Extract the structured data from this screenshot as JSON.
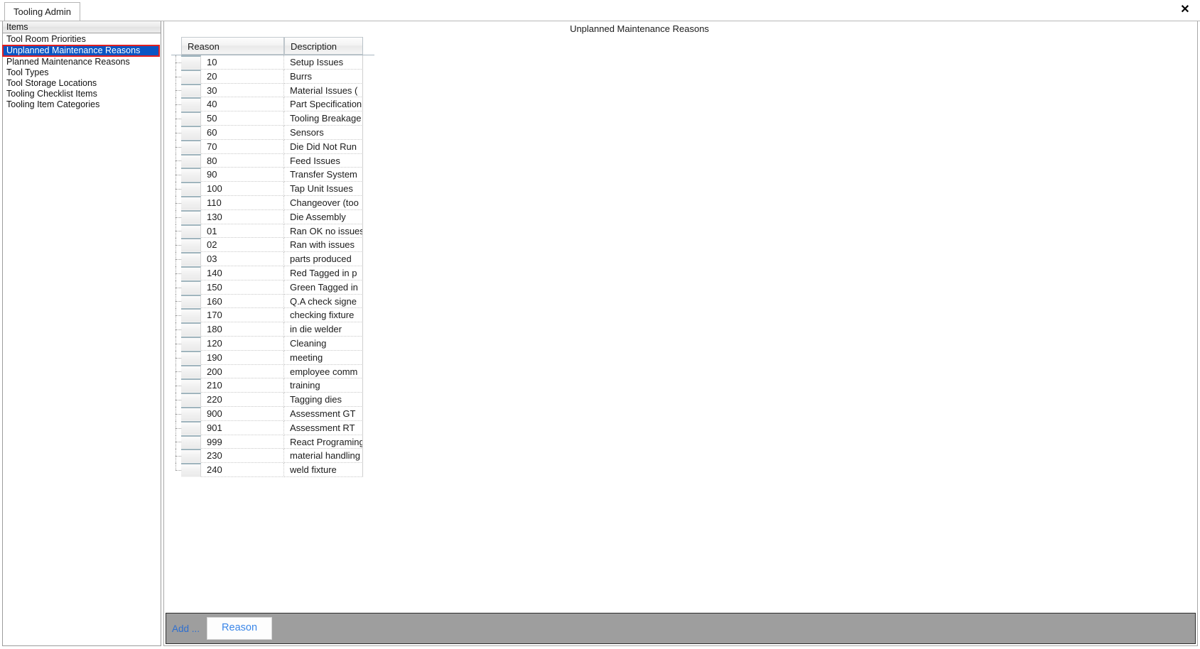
{
  "window": {
    "tab_label": "Tooling Admin",
    "close_icon": "close-icon",
    "close_glyph": "✕"
  },
  "sidebar": {
    "header": "Items",
    "selected_index": 1,
    "selection_colors": {
      "background": "#0a55c4",
      "text": "#ffffff",
      "outline": "#e02020"
    },
    "items": [
      {
        "label": "Tool Room Priorities"
      },
      {
        "label": "Unplanned Maintenance Reasons"
      },
      {
        "label": "Planned Maintenance Reasons"
      },
      {
        "label": "Tool Types"
      },
      {
        "label": "Tool Storage Locations"
      },
      {
        "label": "Tooling Checklist Items"
      },
      {
        "label": "Tooling Item Categories"
      }
    ]
  },
  "content": {
    "title": "Unplanned Maintenance Reasons",
    "grid": {
      "columns": [
        {
          "key": "reason",
          "label": "Reason"
        },
        {
          "key": "description",
          "label": "Description"
        }
      ],
      "rows": [
        {
          "reason": "10",
          "description": "Setup Issues"
        },
        {
          "reason": "20",
          "description": "Burrs"
        },
        {
          "reason": "30",
          "description": "Material Issues ("
        },
        {
          "reason": "40",
          "description": "Part Specification"
        },
        {
          "reason": "50",
          "description": "Tooling Breakage"
        },
        {
          "reason": "60",
          "description": "Sensors"
        },
        {
          "reason": "70",
          "description": "Die Did Not Run"
        },
        {
          "reason": "80",
          "description": "Feed Issues"
        },
        {
          "reason": "90",
          "description": "Transfer System"
        },
        {
          "reason": "100",
          "description": "Tap Unit Issues"
        },
        {
          "reason": "110",
          "description": "Changeover  (too"
        },
        {
          "reason": "130",
          "description": "Die Assembly"
        },
        {
          "reason": "01",
          "description": "Ran OK no issues"
        },
        {
          "reason": "02",
          "description": "Ran with issues"
        },
        {
          "reason": "03",
          "description": "parts produced"
        },
        {
          "reason": "140",
          "description": "Red Tagged in p"
        },
        {
          "reason": "150",
          "description": "Green Tagged in"
        },
        {
          "reason": "160",
          "description": "Q.A check signe"
        },
        {
          "reason": "170",
          "description": "checking fixture"
        },
        {
          "reason": "180",
          "description": "in die welder"
        },
        {
          "reason": "120",
          "description": "Cleaning"
        },
        {
          "reason": "190",
          "description": "meeting"
        },
        {
          "reason": "200",
          "description": "employee  comm"
        },
        {
          "reason": "210",
          "description": "training"
        },
        {
          "reason": "220",
          "description": "Tagging dies"
        },
        {
          "reason": "900",
          "description": "Assessment GT"
        },
        {
          "reason": "901",
          "description": "Assessment RT"
        },
        {
          "reason": "999",
          "description": "React Programing"
        },
        {
          "reason": "230",
          "description": "material handling"
        },
        {
          "reason": "240",
          "description": "weld fixture"
        }
      ]
    }
  },
  "bottom_bar": {
    "add_label": "Add ...",
    "reason_button": "Reason",
    "link_color": "#2e6fd0",
    "bar_color": "#9e9e9e"
  }
}
